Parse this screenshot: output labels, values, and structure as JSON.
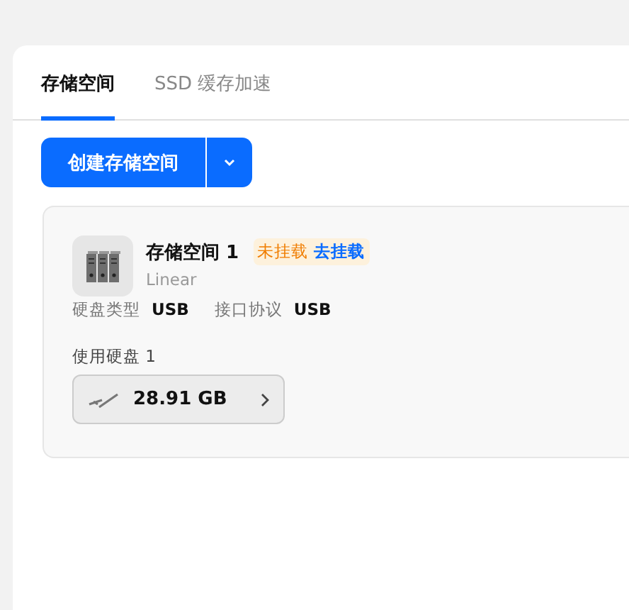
{
  "tabs": [
    {
      "label": "存储空间",
      "selected": true
    },
    {
      "label": "SSD 缓存加速",
      "selected": false
    }
  ],
  "create_button": {
    "label": "创建存储空间"
  },
  "pools": [
    {
      "name": "存储空间 1",
      "status": "未挂载",
      "action": "去挂载",
      "type": "Linear",
      "info": [
        {
          "label": "硬盘类型",
          "value": "USB"
        },
        {
          "label": "接口协议",
          "value": "USB"
        }
      ],
      "disks_label": "使用硬盘 1",
      "disks": [
        {
          "size": "28.91 GB"
        }
      ]
    }
  ]
}
